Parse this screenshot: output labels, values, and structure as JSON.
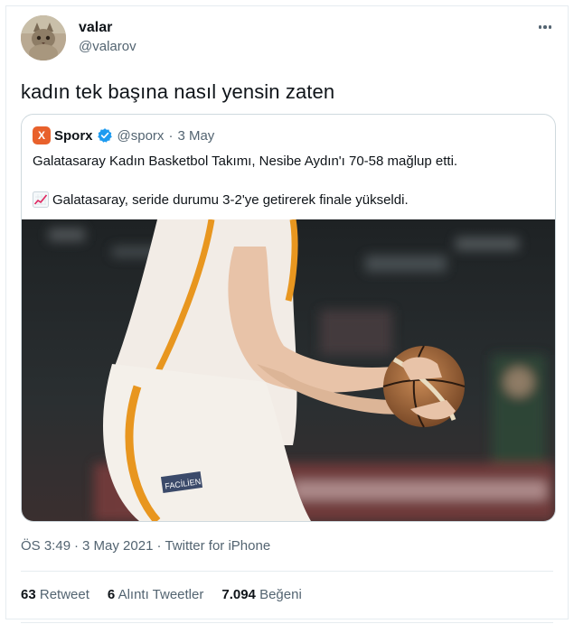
{
  "author": {
    "name": "valar",
    "handle": "@valarov"
  },
  "tweet": {
    "text": "kadın tek başına nasıl yensin zaten"
  },
  "quoted": {
    "logo_letter": "X",
    "name": "Sporx",
    "handle": "@sporx",
    "separator": "·",
    "date": "3 May",
    "line1": "Galatasaray Kadın Basketbol Takımı, Nesibe Aydın'ı 70-58 mağlup etti.",
    "line2": "Galatasaray, seride durumu 3-2'ye getirerek finale yükseldi.",
    "photo_jersey_text": "FACİLİEN"
  },
  "meta": {
    "time": "ÖS 3:49",
    "separator": "·",
    "date": "3 May 2021",
    "source": "Twitter for iPhone"
  },
  "stats": {
    "retweets_count": "63",
    "retweets_label": "Retweet",
    "quotes_count": "6",
    "quotes_label": "Alıntı Tweetler",
    "likes_count": "7.094",
    "likes_label": "Beğeni"
  },
  "colors": {
    "verified": "#1d9bf0",
    "sporx_brand": "#e8612c",
    "muted_text": "#536471",
    "border": "#cfd9de"
  },
  "icons": {
    "more": "more-options-icon",
    "verified": "verified-badge-icon",
    "chart": "chart-increasing-emoji"
  }
}
